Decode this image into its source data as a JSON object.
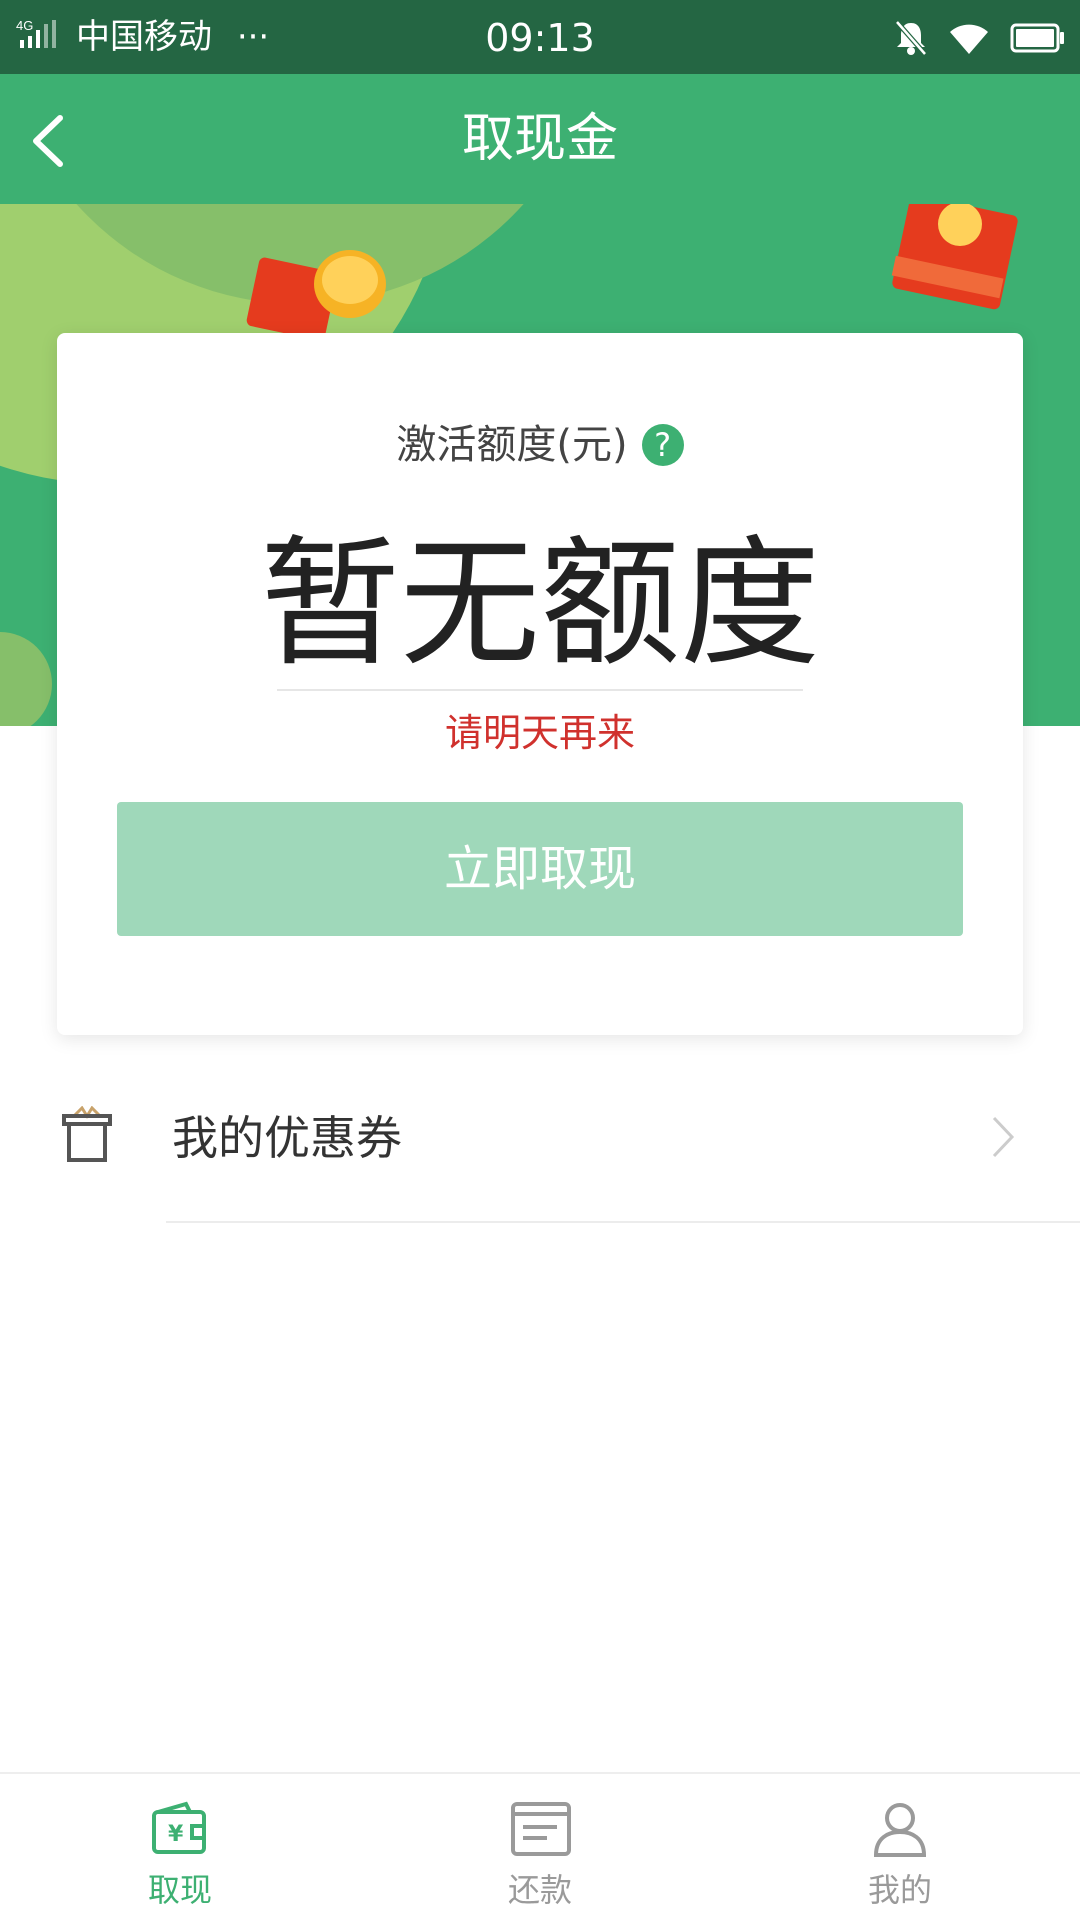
{
  "status_bar": {
    "network": "4G",
    "carrier": "中国移动",
    "more": "···",
    "time": "09:13"
  },
  "header": {
    "title": "取现金",
    "back_icon": "chevron-left-icon"
  },
  "card": {
    "label": "激活额度(元)",
    "help_symbol": "?",
    "amount_text": "暂无额度",
    "hint": "请明天再来",
    "button_label": "立即取现"
  },
  "coupon": {
    "label": "我的优惠券",
    "icon": "gift-box-icon"
  },
  "tabbar": {
    "tabs": [
      {
        "label": "取现",
        "icon": "wallet-icon",
        "active": true
      },
      {
        "label": "还款",
        "icon": "bill-icon",
        "active": false
      },
      {
        "label": "我的",
        "icon": "user-icon",
        "active": false
      }
    ]
  },
  "colors": {
    "brand_green": "#3db072",
    "status_bar": "#246643",
    "button_disabled": "#9fd8ba",
    "hint_red": "#d0312d",
    "tab_inactive": "#9a9a9a"
  }
}
